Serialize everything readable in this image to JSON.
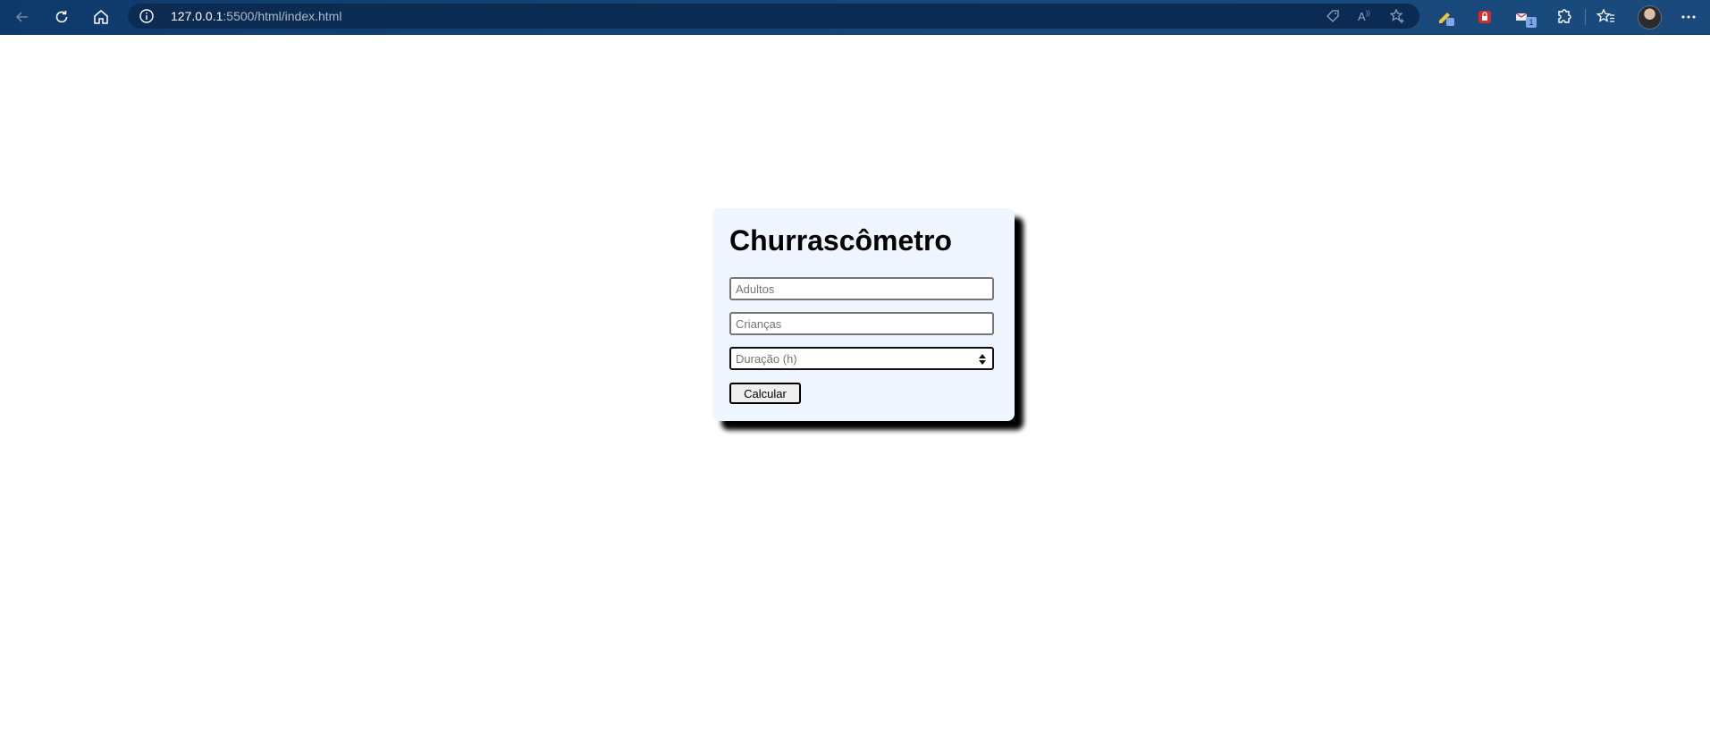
{
  "browser": {
    "url_host": "127.0.0.1",
    "url_rest": ":5500/html/index.html"
  },
  "page": {
    "title": "Churrascômetro",
    "fields": {
      "adults_placeholder": "Adultos",
      "children_placeholder": "Crianças",
      "duration_placeholder": "Duração (h)"
    },
    "calculate_label": "Calcular"
  },
  "extensions": {
    "badge_count": "1"
  },
  "colors": {
    "chrome": "#17487a",
    "card": "#f0f6ff"
  }
}
